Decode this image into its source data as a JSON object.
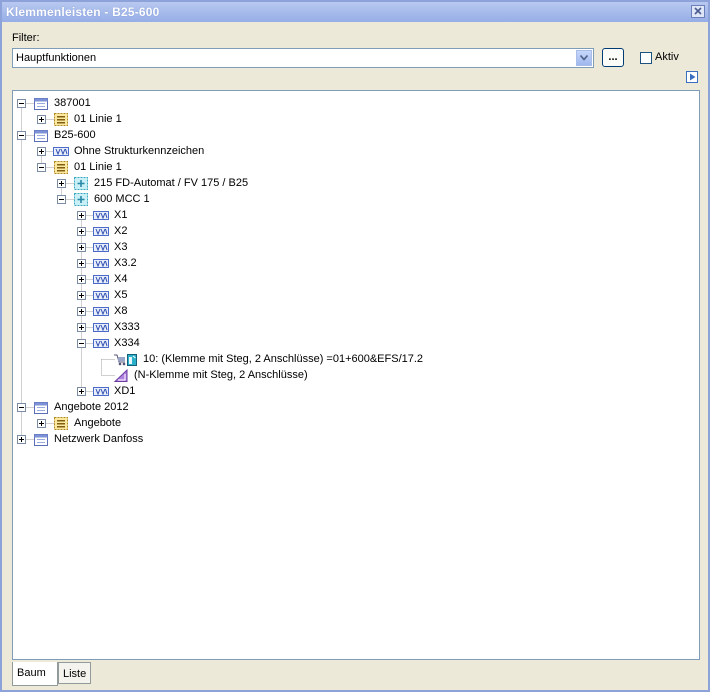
{
  "window": {
    "title": "Klemmenleisten - B25-600"
  },
  "filter": {
    "label": "Filter:",
    "value": "Hauptfunktionen",
    "browse_label": "...",
    "aktiv_label": "Aktiv",
    "aktiv_checked": false
  },
  "tree": [
    {
      "label": "387001",
      "icon": "project-icon",
      "exp": "−",
      "level": 0
    },
    {
      "label": "01 Linie 1",
      "icon": "line-icon",
      "exp": "+",
      "level": 1
    },
    {
      "label": "B25-600",
      "icon": "project-icon",
      "exp": "−",
      "level": 0
    },
    {
      "label": "Ohne Strukturkennzeichen",
      "icon": "terminal-strip-icon",
      "exp": "+",
      "level": 1
    },
    {
      "label": "01 Linie 1",
      "icon": "line-icon",
      "exp": "−",
      "level": 1
    },
    {
      "label": "215 FD-Automat / FV 175 / B25",
      "icon": "location-icon",
      "exp": "+",
      "level": 2
    },
    {
      "label": "600 MCC 1",
      "icon": "location-icon",
      "exp": "−",
      "level": 2
    },
    {
      "label": "X1",
      "icon": "terminal-strip-icon",
      "exp": "+",
      "level": 3
    },
    {
      "label": "X2",
      "icon": "terminal-strip-icon",
      "exp": "+",
      "level": 3
    },
    {
      "label": "X3",
      "icon": "terminal-strip-icon",
      "exp": "+",
      "level": 3
    },
    {
      "label": "X3.2",
      "icon": "terminal-strip-icon",
      "exp": "+",
      "level": 3
    },
    {
      "label": "X4",
      "icon": "terminal-strip-icon",
      "exp": "+",
      "level": 3
    },
    {
      "label": "X5",
      "icon": "terminal-strip-icon",
      "exp": "+",
      "level": 3
    },
    {
      "label": "X8",
      "icon": "terminal-strip-icon",
      "exp": "+",
      "level": 3
    },
    {
      "label": "X333",
      "icon": "terminal-strip-icon",
      "exp": "+",
      "level": 3
    },
    {
      "label": "X334",
      "icon": "terminal-strip-icon",
      "exp": "−",
      "level": 3
    },
    {
      "label": "10: (Klemme mit Steg, 2 Anschlüsse) =01+600&EFS/17.2",
      "icon": "terminal-icon",
      "exp": "",
      "level": 4
    },
    {
      "label": "(N-Klemme mit Steg, 2 Anschlüsse)",
      "icon": "n-terminal-icon",
      "exp": "",
      "level": 4
    },
    {
      "label": "XD1",
      "icon": "terminal-strip-icon",
      "exp": "+",
      "level": 3
    },
    {
      "label": "Angebote 2012",
      "icon": "project-icon",
      "exp": "−",
      "level": 0
    },
    {
      "label": "Angebote",
      "icon": "line-icon",
      "exp": "+",
      "level": 1
    },
    {
      "label": "Netzwerk Danfoss",
      "icon": "project-icon",
      "exp": "+",
      "level": 0
    }
  ],
  "tabs": [
    {
      "label": "Baum",
      "active": true
    },
    {
      "label": "Liste",
      "active": false
    }
  ]
}
